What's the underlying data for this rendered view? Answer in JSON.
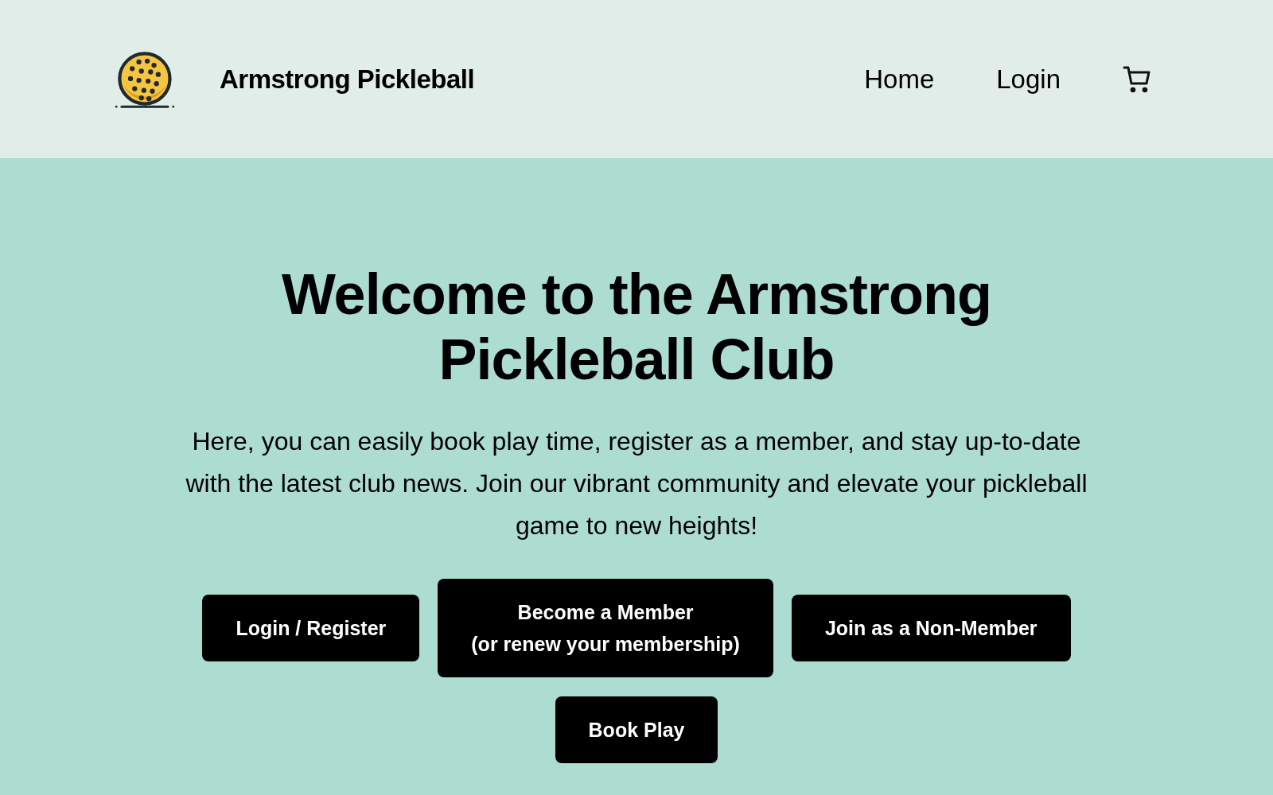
{
  "header": {
    "brand": "Armstrong Pickleball",
    "nav": [
      {
        "label": "Home"
      },
      {
        "label": "Login"
      }
    ]
  },
  "hero": {
    "title": "Welcome to the Armstrong Pickleball Club",
    "text": "Here, you can easily book play time, register as a member, and stay up-to-date with the latest club news. Join our vibrant community and elevate your pickleball game to new heights!",
    "buttons": [
      {
        "label": "Login / Register"
      },
      {
        "label": "Become a Member\n(or renew your membership)"
      },
      {
        "label": "Join as a Non-Member"
      },
      {
        "label": "Book Play"
      }
    ]
  }
}
